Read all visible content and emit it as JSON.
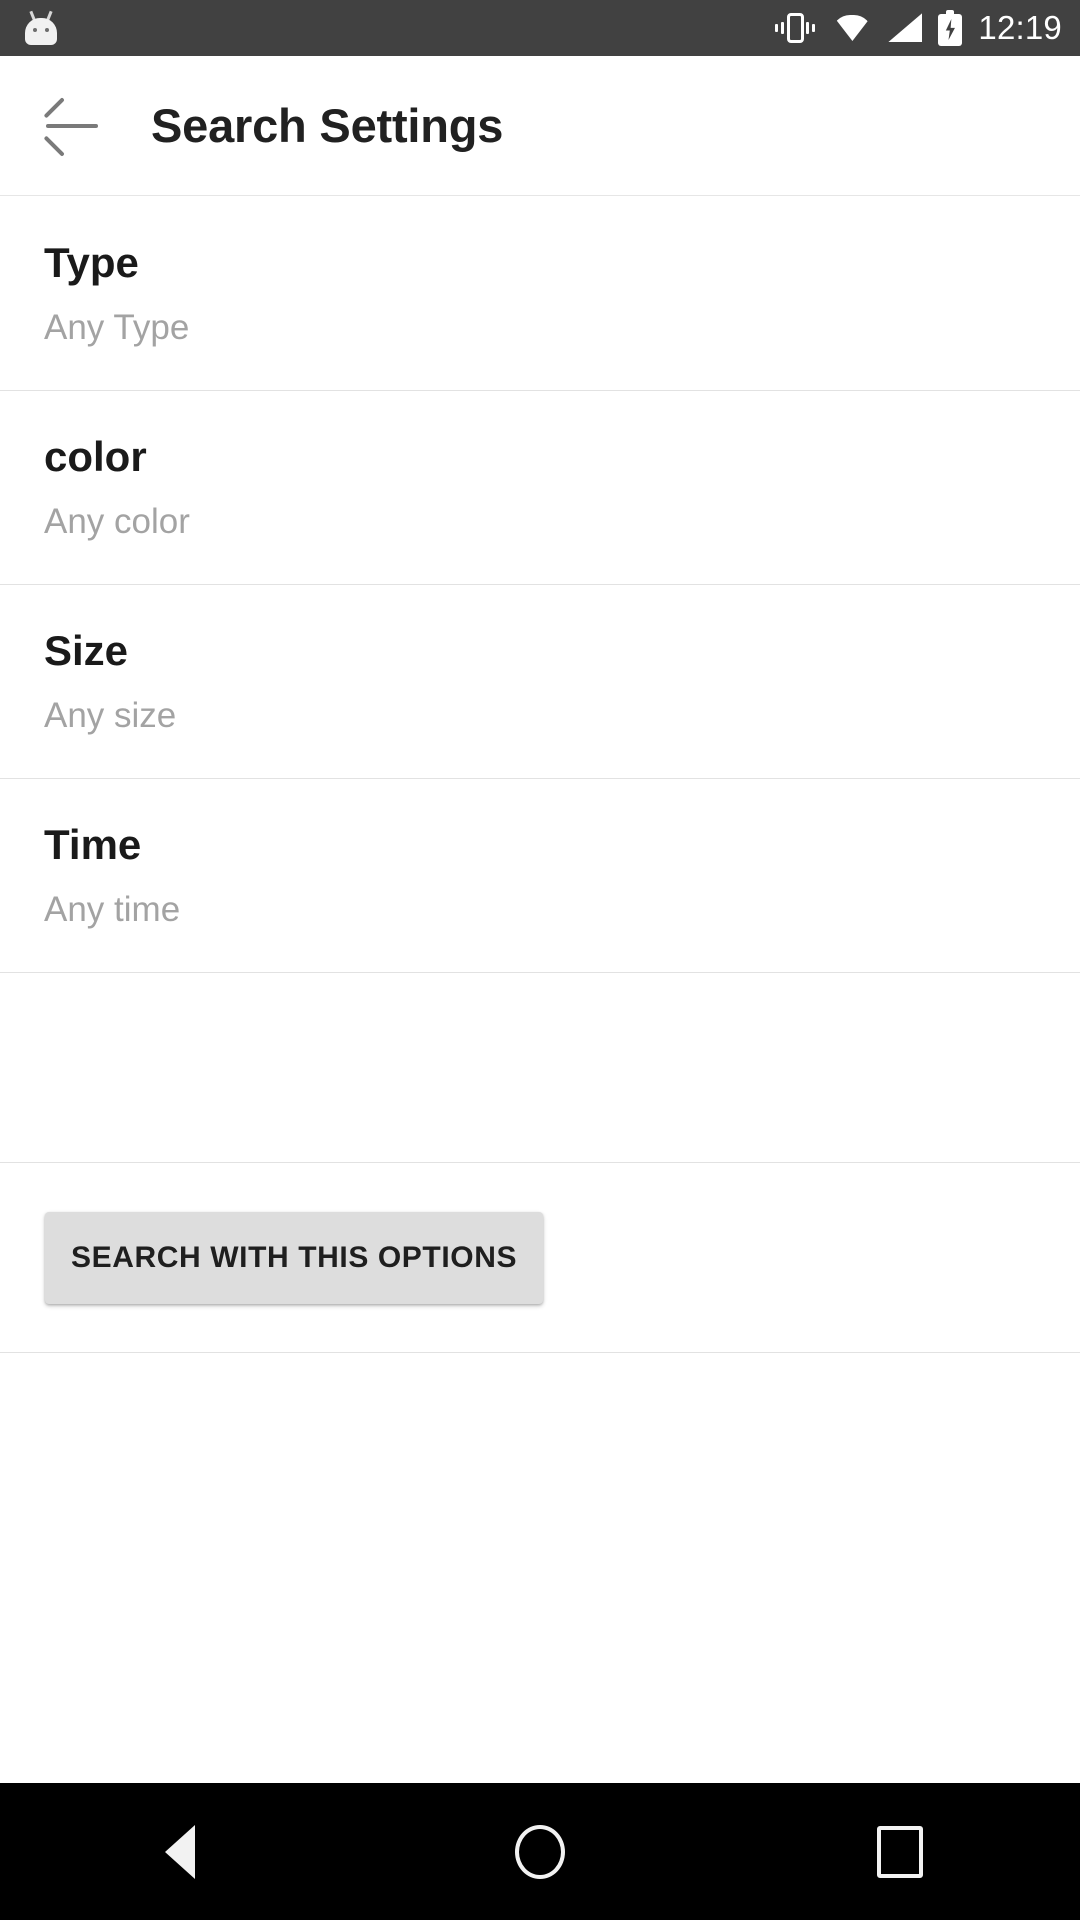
{
  "status_bar": {
    "time": "12:19",
    "background_color": "#414141",
    "icons": [
      {
        "name": "android-mascot-icon"
      },
      {
        "name": "vibrate-icon"
      },
      {
        "name": "wifi-icon"
      },
      {
        "name": "cellular-signal-icon"
      },
      {
        "name": "battery-charging-icon"
      }
    ]
  },
  "app_bar": {
    "back_label": "back-arrow",
    "title": "Search Settings"
  },
  "settings": {
    "rows": [
      {
        "title": "Type",
        "value": "Any Type"
      },
      {
        "title": "color",
        "value": "Any color"
      },
      {
        "title": "Size",
        "value": "Any size"
      },
      {
        "title": "Time",
        "value": "Any time"
      }
    ]
  },
  "action": {
    "search_button_label": "SEARCH WITH THIS OPTIONS",
    "button_color": "#dddddd"
  },
  "nav_bar": {
    "background_color": "#000000",
    "buttons": [
      {
        "name": "nav-back-button"
      },
      {
        "name": "nav-home-button"
      },
      {
        "name": "nav-recents-button"
      }
    ]
  },
  "theme": {
    "title_color": "#1a1a1a",
    "subtitle_color": "#a3a3a3",
    "divider_color": "#e2e2e2"
  }
}
